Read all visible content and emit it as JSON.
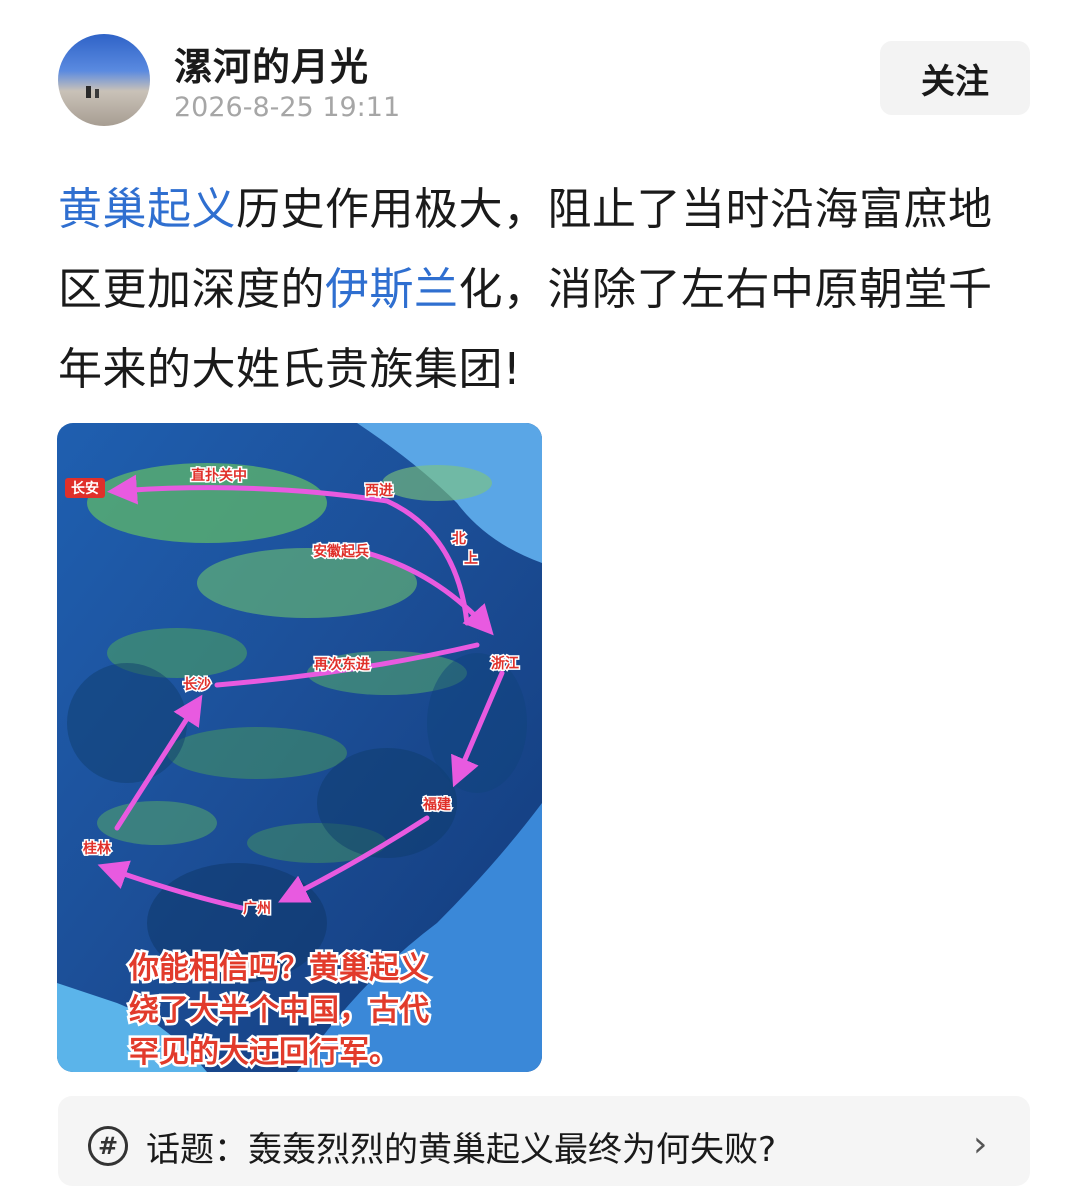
{
  "author": {
    "name": "漯河的月光",
    "time": "2026-8-25 19:11",
    "follow_label": "关注"
  },
  "post": {
    "segments": [
      {
        "text": "黄巢起义",
        "link": true
      },
      {
        "text": "历史作用极大，阻止了当时沿海富庶地区更加深度的",
        "link": false
      },
      {
        "text": "伊斯兰",
        "link": true
      },
      {
        "text": "化，消除了左右中原朝堂千年来的大姓氏贵族集团!",
        "link": false
      }
    ]
  },
  "map": {
    "labels": {
      "changan": "长安",
      "zhipu": "直扑关中",
      "xijin": "西进",
      "beishang_1": "北",
      "beishang_2": "上",
      "anhui": "安徽起兵",
      "zhejiang": "浙江",
      "zaici": "再次东进",
      "changsha": "长沙",
      "fujian": "福建",
      "guilin": "桂林",
      "guangzhou": "广州"
    },
    "caption": [
      "你能相信吗？黄巢起义",
      "绕了大半个中国，古代",
      "罕见的大迂回行军。"
    ],
    "colors": {
      "arrow": "#e85ae0",
      "label_red": "#e0302a",
      "caption_red": "#e23b2b"
    }
  },
  "topic": {
    "icon": "#",
    "text": "话题：轰轰烈烈的黄巢起义最终为何失败?",
    "chevron": "›"
  }
}
